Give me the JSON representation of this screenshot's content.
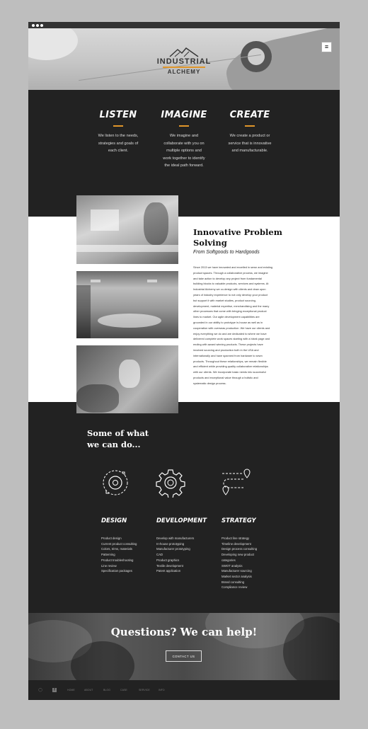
{
  "header": {
    "menu_icon": "hamburger-icon",
    "logo_line1": "INDUSTRIAL",
    "logo_line2": "ALCHEMY",
    "logo_icon": "mountain-icon",
    "accent": "#e0962a"
  },
  "pillars": [
    {
      "title": "LISTEN",
      "text": [
        "We listen to the needs,",
        "strategies and goals of",
        "each client."
      ]
    },
    {
      "title": "IMAGINE",
      "text": [
        "We imagine and",
        "collaborate with you on",
        "multiple options and",
        "work together to identify",
        "the ideal path forward."
      ]
    },
    {
      "title": "CREATE",
      "text": [
        "We create a product or",
        "service that is innovative",
        "and manufacturable."
      ]
    }
  ],
  "article": {
    "title_line1": "Innovative Problem",
    "title_line2": "Solving",
    "subtitle": "From Softgoods to Hardgoods",
    "body": [
      "Since 2013 we have innovated and excelled in sewn and existing",
      "product spaces. Through a collaborative process, we imagine",
      "and take action to develop any project from fundamental",
      "building blocks to valuable products, services and systems. At",
      "Industrial Alchemy we co-design with clients and draw upon",
      "years of industry experience to not only develop your product",
      "but support it with market studies, product sourcing,",
      "development, material expertise, merchandising and the many",
      "other processes that come with bringing exceptional product",
      "lines to market. Our agile development capabilities are",
      "grounded in our ability to prototype in-house as well as in",
      "cooperation with overseas production. We have our clients and",
      "enjoy everything we do and are dedicated to where we have",
      "delivered complete work spaces starting with a blank page and",
      "ending with award winning products. These projects have",
      "involved sourcing and production both in the USA and",
      "internationally and have spanned from hardware to sewn",
      "products. Throughout these relationships, we remain flexible",
      "and efficient while providing quality collaborative relationships",
      "with our clients. We incorporate basic needs into successful",
      "products and exceptional value through a holistic and",
      "systematic design process."
    ]
  },
  "services": {
    "heading_line1": "Some of what",
    "heading_line2": "we can do...",
    "columns": [
      {
        "title": "DESIGN",
        "icon": "gear-cycle-icon",
        "items": [
          "Product design",
          "Current product consulting",
          "Colors, trims, materials",
          "Patterning",
          "Product troubleshooting",
          "Line review",
          "Specification packages"
        ]
      },
      {
        "title": "DEVELOPMENT",
        "icon": "gear-icon",
        "items": [
          "Develop with manufacturers",
          "In-house prototyping",
          "Manufacturer prototyping",
          "CAD",
          "Product graphics",
          "Textile development",
          "Patent application"
        ]
      },
      {
        "title": "STRATEGY",
        "icon": "route-map-icon",
        "items": [
          "Product line strategy",
          "Timeline development",
          "Design process consulting",
          "Developing new product",
          "categories",
          "SWOT analysis",
          "Manufacturer sourcing",
          "Market sector analysis",
          "Brand consulting",
          "Compliance review"
        ]
      }
    ]
  },
  "cta": {
    "heading": "Questions? We can help!",
    "button": "CONTACT US"
  },
  "footer": {
    "social": [
      "instagram-icon",
      "facebook-icon"
    ],
    "links": [
      "HOME",
      "ABOUT",
      "BLOG",
      "CASE",
      "SERVICE",
      "INFO"
    ]
  }
}
